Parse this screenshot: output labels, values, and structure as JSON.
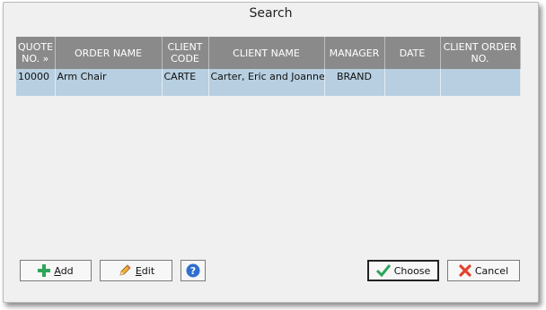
{
  "dialog": {
    "title": "Search"
  },
  "grid": {
    "columns": [
      "QUOTE NO. »",
      "ORDER NAME",
      "CLIENT CODE",
      "CLIENT NAME",
      "MANAGER",
      "DATE",
      "CLIENT ORDER NO."
    ],
    "rows": [
      {
        "quote_no": "10000",
        "order_name": "Arm Chair",
        "client_code": "CARTE",
        "client_name": "Carter, Eric and Joanne",
        "manager": "BRAND",
        "date": "",
        "client_order_no": ""
      }
    ]
  },
  "buttons": {
    "add": {
      "access": "A",
      "rest": "dd",
      "icon": "plus-icon"
    },
    "edit": {
      "access": "E",
      "rest": "dit",
      "icon": "pencil-icon"
    },
    "help": {
      "icon": "help-icon"
    },
    "choose": {
      "label": "Choose",
      "icon": "checkmark-icon"
    },
    "cancel": {
      "label": "Cancel",
      "icon": "x-icon"
    }
  },
  "colors": {
    "header_bg": "#8a8a8a",
    "selected_row_bg": "#b7cfe0",
    "add_green": "#2ea55a",
    "help_blue": "#2f6fd0",
    "cancel_red": "#e2442f"
  }
}
